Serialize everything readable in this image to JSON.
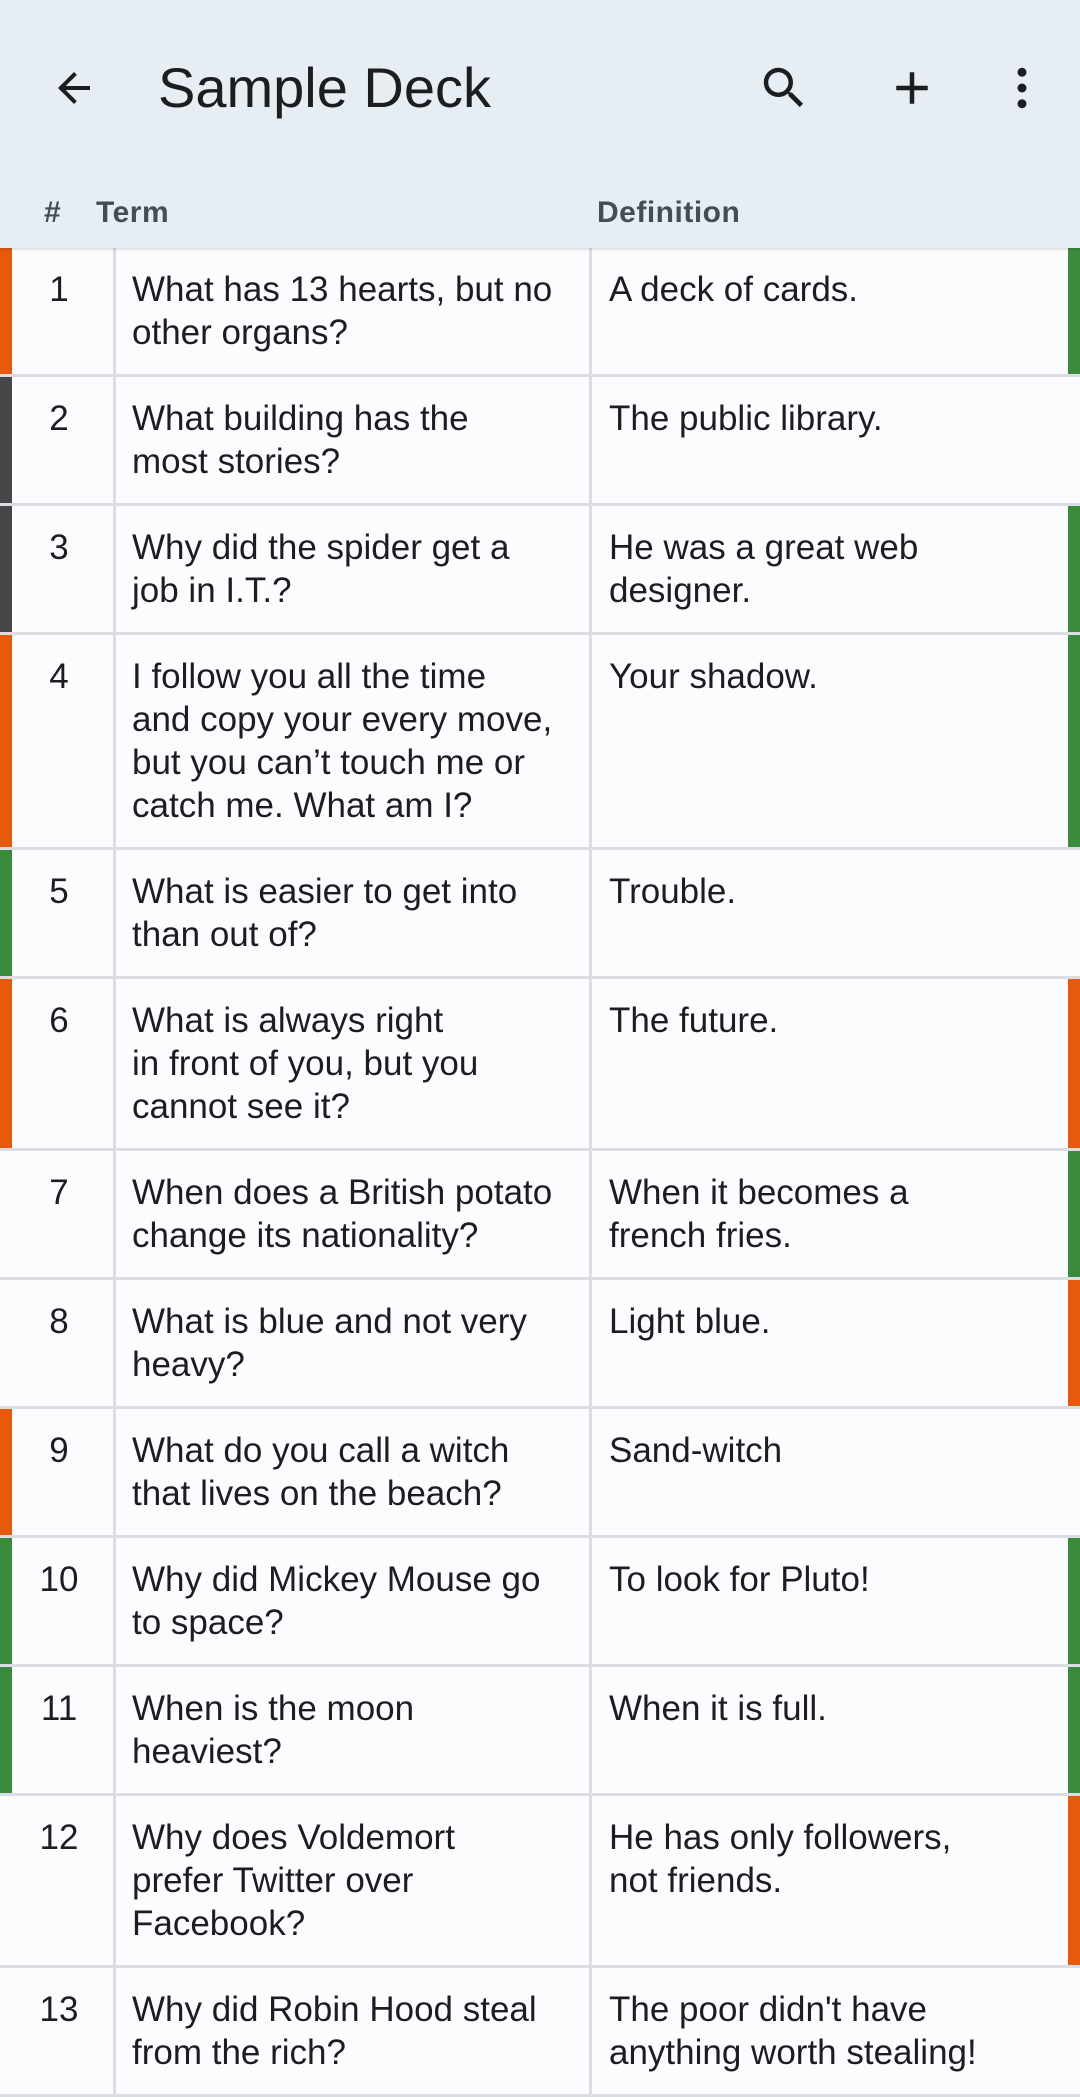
{
  "appbar": {
    "title": "Sample Deck",
    "back_icon": "arrow-back-icon",
    "search_icon": "search-icon",
    "add_icon": "add-icon",
    "more_icon": "more-vert-icon"
  },
  "columns": {
    "number": "#",
    "term": "Term",
    "definition": "Definition"
  },
  "colors": {
    "orange": "#e65a0e",
    "green": "#3a8b3d",
    "grey": "#464648",
    "header_bg": "#e6edf3"
  },
  "rows": [
    {
      "num": "1",
      "term": "What has 13 hearts, but no\nother organs?",
      "definition": "A deck of cards.",
      "left": "orange",
      "right": "green"
    },
    {
      "num": "2",
      "term": "What building has the\nmost stories?",
      "definition": "The public library.",
      "left": "grey",
      "right": "none"
    },
    {
      "num": "3",
      "term": "Why did the spider get a\njob in I.T.?",
      "definition": "He was a great web\ndesigner.",
      "left": "grey",
      "right": "green"
    },
    {
      "num": "4",
      "term": "I follow you all the time\nand copy your every move,\nbut you can’t touch me or\ncatch me. What am I?",
      "definition": "Your shadow.",
      "left": "orange",
      "right": "green"
    },
    {
      "num": "5",
      "term": "What is easier to get into\nthan out of?",
      "definition": "Trouble.",
      "left": "green",
      "right": "none"
    },
    {
      "num": "6",
      "term": "What is always right\nin front of you, but you\ncannot see it?",
      "definition": "The future.",
      "left": "orange",
      "right": "orange"
    },
    {
      "num": "7",
      "term": "When does a British potato\nchange its nationality?",
      "definition": "When it becomes a\nfrench fries.",
      "left": "none",
      "right": "green"
    },
    {
      "num": "8",
      "term": "What is blue and not very\nheavy?",
      "definition": "Light blue.",
      "left": "none",
      "right": "orange"
    },
    {
      "num": "9",
      "term": "What do you call a witch\nthat lives on the beach?",
      "definition": "Sand-witch",
      "left": "orange",
      "right": "none"
    },
    {
      "num": "10",
      "term": "Why did Mickey Mouse go\nto space?",
      "definition": "To look for Pluto!",
      "left": "green",
      "right": "green"
    },
    {
      "num": "11",
      "term": "When is the moon\nheaviest?",
      "definition": "When it is full.",
      "left": "green",
      "right": "green"
    },
    {
      "num": "12",
      "term": "Why does Voldemort\nprefer Twitter over\nFacebook?",
      "definition": "He has only followers,\nnot friends.",
      "left": "none",
      "right": "orange"
    },
    {
      "num": "13",
      "term": "Why did Robin Hood steal\nfrom the rich?",
      "definition": "The poor didn't have\nanything worth stealing!",
      "left": "none",
      "right": "none"
    }
  ]
}
